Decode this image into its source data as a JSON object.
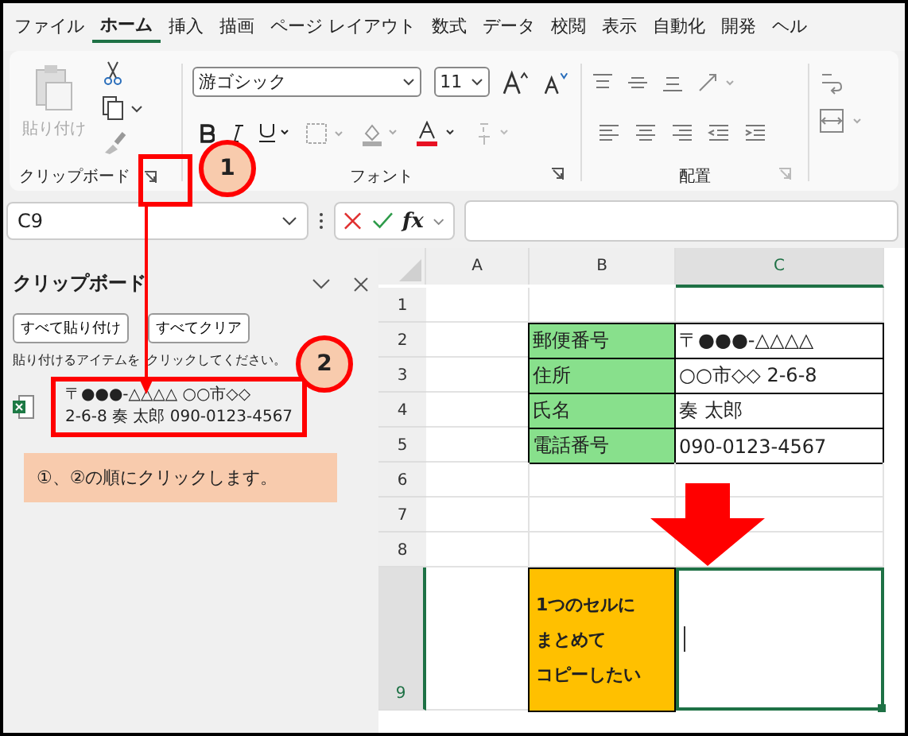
{
  "menu_tabs": [
    {
      "label": "ファイル",
      "selected": false
    },
    {
      "label": "ホーム",
      "selected": true
    },
    {
      "label": "挿入",
      "selected": false
    },
    {
      "label": "描画",
      "selected": false
    },
    {
      "label": "ページ レイアウト",
      "selected": false
    },
    {
      "label": "数式",
      "selected": false
    },
    {
      "label": "データ",
      "selected": false
    },
    {
      "label": "校閲",
      "selected": false
    },
    {
      "label": "表示",
      "selected": false
    },
    {
      "label": "自動化",
      "selected": false
    },
    {
      "label": "開発",
      "selected": false
    },
    {
      "label": "ヘル",
      "selected": false
    }
  ],
  "ribbon": {
    "paste_label": "貼り付け",
    "font_name": "游ゴシック",
    "font_size": "11",
    "groups": [
      "クリップボード",
      "フォント",
      "配置"
    ]
  },
  "annotations": [
    {
      "number": "1"
    },
    {
      "number": "2"
    }
  ],
  "formula_bar": {
    "name_box": "C9",
    "fx": "fx"
  },
  "clipboard_pane": {
    "title": "クリップボード",
    "buttons": [
      "すべて貼り付け",
      "すべてクリア"
    ],
    "hint": "貼り付けるアイテムをクリックしてください。",
    "items": [
      {
        "lines": [
          "〒●●●-△△△△ ○○市◇◇",
          "2-6-8 奏 太郎 090-0123-4567"
        ]
      }
    ],
    "note": "①、②の順にクリックします。"
  },
  "sheet": {
    "columns": [
      {
        "label": "A",
        "selected": false
      },
      {
        "label": "B",
        "selected": false
      },
      {
        "label": "C",
        "selected": true
      }
    ],
    "rows": [
      {
        "label": "1",
        "selected": false
      },
      {
        "label": "2",
        "selected": false,
        "B": {
          "text": "郵便番号",
          "color": "#88e08c"
        },
        "C": {
          "text": "〒●●●-△△△△"
        }
      },
      {
        "label": "3",
        "selected": false,
        "B": {
          "text": "住所",
          "color": "#88e08c"
        },
        "C": {
          "text": "○○市◇◇ 2-6-8"
        }
      },
      {
        "label": "4",
        "selected": false,
        "B": {
          "text": "氏名",
          "color": "#88e08c"
        },
        "C": {
          "text": "奏 太郎"
        }
      },
      {
        "label": "5",
        "selected": false,
        "B": {
          "text": "電話番号",
          "color": "#88e08c"
        },
        "C": {
          "text": "090-0123-4567"
        }
      },
      {
        "label": "6",
        "selected": false
      },
      {
        "label": "7",
        "selected": false
      },
      {
        "label": "8",
        "selected": false
      },
      {
        "label": "9",
        "selected": true,
        "B": {
          "lines": [
            "1つのセルに",
            "まとめて",
            "コピーしたい"
          ],
          "color": "#ffc000"
        },
        "C": {
          "selected": true
        }
      }
    ]
  }
}
